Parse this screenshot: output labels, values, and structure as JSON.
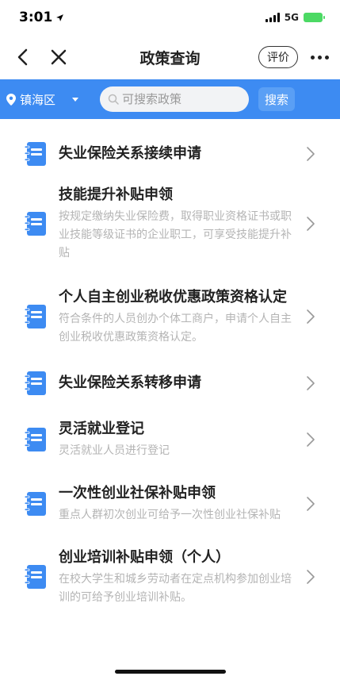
{
  "status": {
    "time": "3:01",
    "network": "5G"
  },
  "nav": {
    "title": "政策查询",
    "rate_label": "评价"
  },
  "search": {
    "region": "镇海区",
    "placeholder": "可搜索政策",
    "button": "搜索"
  },
  "colors": {
    "accent": "#3d8bf2",
    "icon": "#3d8bf2"
  },
  "items": [
    {
      "title": "失业保险关系接续申请",
      "desc": ""
    },
    {
      "title": "技能提升补贴申领",
      "desc": "按规定缴纳失业保险费，取得职业资格证书或职业技能等级证书的企业职工，可享受技能提升补贴"
    },
    {
      "title": "个人自主创业税收优惠政策资格认定",
      "desc": "符合条件的人员创办个体工商户，申请个人自主创业税收优惠政策资格认定。"
    },
    {
      "title": "失业保险关系转移申请",
      "desc": ""
    },
    {
      "title": "灵活就业登记",
      "desc": "灵活就业人员进行登记"
    },
    {
      "title": "一次性创业社保补贴申领",
      "desc": "重点人群初次创业可给予一次性创业社保补贴"
    },
    {
      "title": "创业培训补贴申领（个人）",
      "desc": "在校大学生和城乡劳动者在定点机构参加创业培训的可给予创业培训补贴。"
    }
  ]
}
